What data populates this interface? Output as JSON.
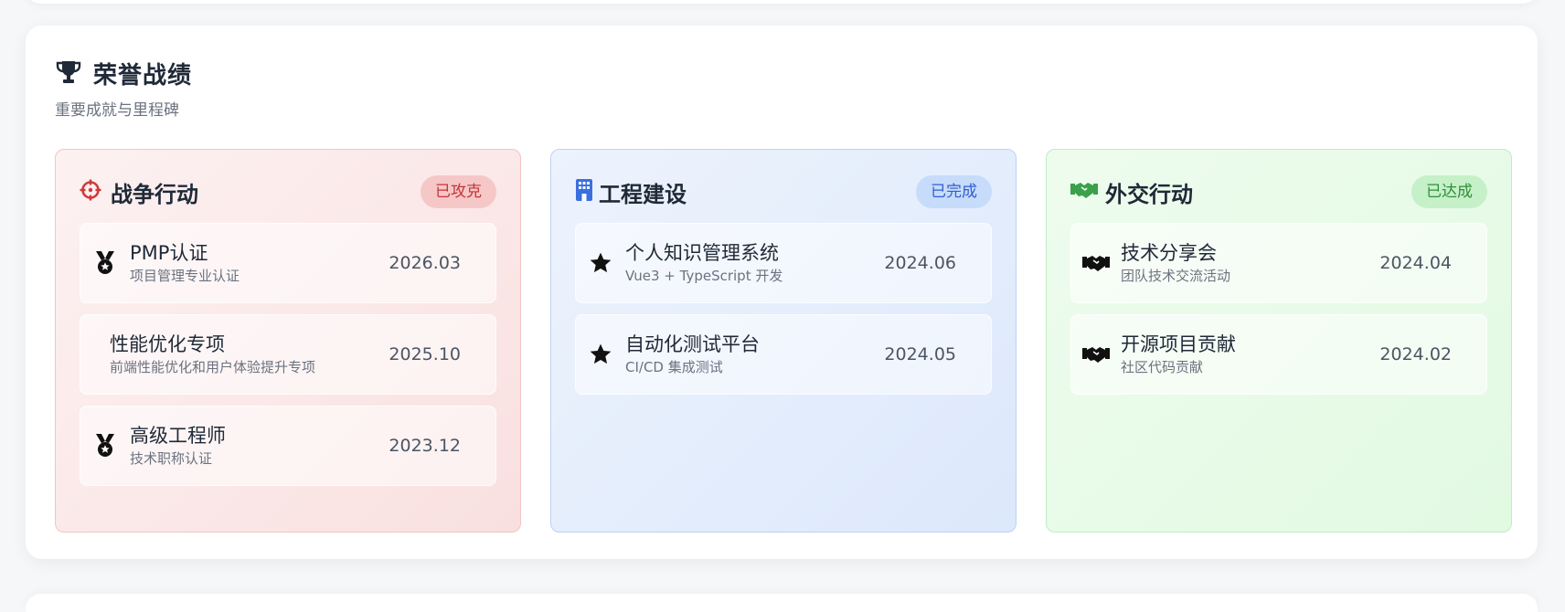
{
  "section": {
    "title": "荣誉战绩",
    "subtitle": "重要成就与里程碑",
    "icon": "trophy-icon"
  },
  "cards": [
    {
      "title": "战争行动",
      "badge": "已攻克",
      "icon": "crosshair-icon",
      "accent": "#d03a3a",
      "items": [
        {
          "title": "PMP认证",
          "desc": "项目管理专业认证",
          "date": "2026.03",
          "icon": "medal-icon"
        },
        {
          "title": "性能优化专项",
          "desc": "前端性能优化和用户体验提升专项",
          "date": "2025.10",
          "icon": ""
        },
        {
          "title": "高级工程师",
          "desc": "技术职称认证",
          "date": "2023.12",
          "icon": "medal-icon"
        }
      ]
    },
    {
      "title": "工程建设",
      "badge": "已完成",
      "icon": "building-icon",
      "accent": "#3b6fe0",
      "items": [
        {
          "title": "个人知识管理系统",
          "desc": "Vue3 + TypeScript 开发",
          "date": "2024.06",
          "icon": "star-icon"
        },
        {
          "title": "自动化测试平台",
          "desc": "CI/CD 集成测试",
          "date": "2024.05",
          "icon": "star-icon"
        }
      ]
    },
    {
      "title": "外交行动",
      "badge": "已达成",
      "icon": "handshake-icon",
      "accent": "#3aa04a",
      "items": [
        {
          "title": "技术分享会",
          "desc": "团队技术交流活动",
          "date": "2024.04",
          "icon": "handshake-icon"
        },
        {
          "title": "开源项目贡献",
          "desc": "社区代码贡献",
          "date": "2024.02",
          "icon": "handshake-icon"
        }
      ]
    }
  ]
}
